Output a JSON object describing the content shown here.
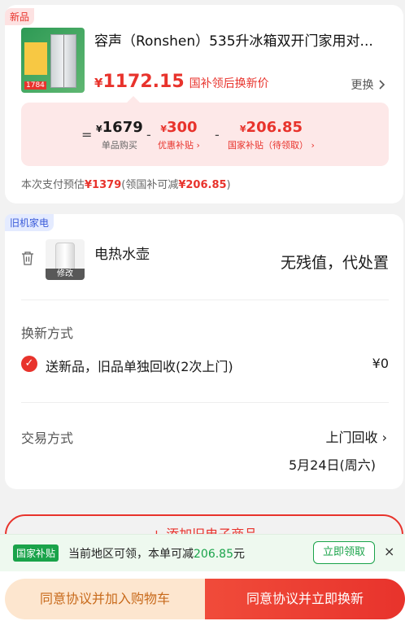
{
  "new_item": {
    "tag": "新品",
    "image_badge": "1784",
    "title": "容声（Ronshen）535升冰箱双开门家用对...",
    "price_symbol": "¥",
    "price": "1172.15",
    "price_desc": "国补领后换新价",
    "swap_label": "更换",
    "calc": {
      "equals": "=",
      "unit_price_symbol": "¥",
      "unit_price": "1679",
      "unit_price_label": "单品购买",
      "minus1": "-",
      "coupon_symbol": "¥",
      "coupon": "300",
      "coupon_label": "优惠补贴 ›",
      "minus2": "-",
      "subsidy_symbol": "¥",
      "subsidy": "206.85",
      "subsidy_label": "国家补贴（待领取） ›"
    },
    "pay_est_prefix": "本次支付预估",
    "pay_est_amount": "¥1379",
    "pay_est_mid": "(领国补可减",
    "pay_est_deduct": "¥206.85",
    "pay_est_suffix": ")"
  },
  "old_item": {
    "tag": "旧机家电",
    "edit_label": "修改",
    "name": "电热水壶",
    "value_text": "无残值，代处置",
    "method_title": "换新方式",
    "method_option": "送新品，旧品单独回收(2次上门)",
    "method_price": "¥0",
    "trade_title": "交易方式",
    "trade_value": "上门回收 ›",
    "trade_date": "5月24日(周六)"
  },
  "add_old_label": "+ 添加旧电子商品",
  "banner": {
    "tag": "国家补贴",
    "text_prefix": "当前地区可领，本单可减",
    "text_amount": "206.85",
    "text_suffix": "元",
    "claim_label": "立即领取",
    "close_icon": "×"
  },
  "actions": {
    "cart_label": "同意协议并加入购物车",
    "now_label": "同意协议并立即换新"
  },
  "colors": {
    "accent": "#e8332c",
    "green": "#1aa34a"
  }
}
